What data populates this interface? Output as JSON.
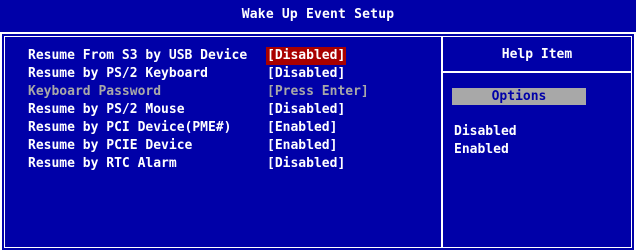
{
  "window": {
    "title": "Wake Up Event Setup"
  },
  "settings": [
    {
      "label": "Resume From S3 by USB Device",
      "value": "[Disabled]"
    },
    {
      "label": "Resume by PS/2 Keyboard",
      "value": "[Disabled]"
    },
    {
      "label": "Keyboard Password",
      "value": "[Press Enter]"
    },
    {
      "label": "Resume by PS/2 Mouse",
      "value": "[Disabled]"
    },
    {
      "label": "Resume by PCI Device(PME#)",
      "value": "[Enabled]"
    },
    {
      "label": "Resume by PCIE Device",
      "value": "[Enabled]"
    },
    {
      "label": "Resume by RTC Alarm",
      "value": "[Disabled]"
    }
  ],
  "help": {
    "title": "Help Item",
    "options_label": "Options",
    "options": [
      "Disabled",
      "Enabled"
    ]
  },
  "colors": {
    "background": "#0000a8",
    "text": "#ffffff",
    "disabled_text": "#a8a8a8",
    "selection": "#a80000"
  }
}
